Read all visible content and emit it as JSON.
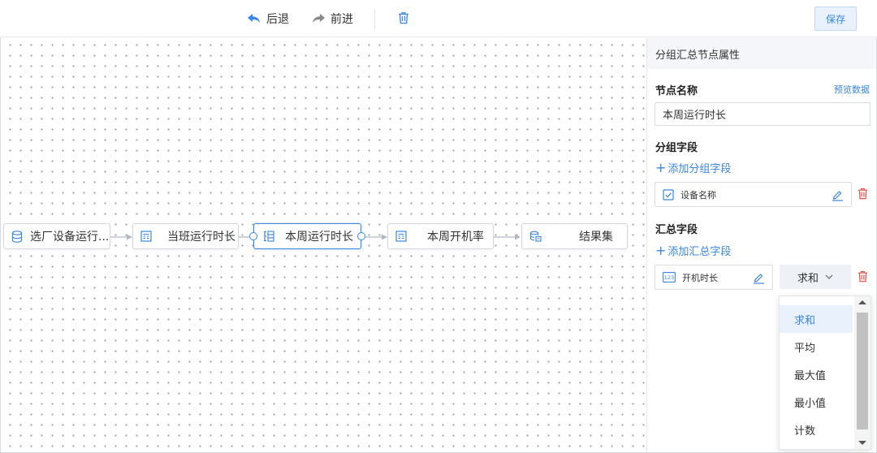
{
  "toolbar": {
    "undo_label": "后退",
    "redo_label": "前进",
    "save_label": "保存"
  },
  "canvas": {
    "nodes": [
      {
        "label": "选厂设备运行...",
        "icon": "database-icon"
      },
      {
        "label": "当班运行时长",
        "icon": "table-icon"
      },
      {
        "label": "本周运行时长",
        "icon": "group-icon",
        "selected": true
      },
      {
        "label": "本周开机率",
        "icon": "table-icon"
      },
      {
        "label": "结果集",
        "icon": "result-icon"
      }
    ]
  },
  "panel": {
    "title": "分组汇总节点属性",
    "node_name_label": "节点名称",
    "preview_label": "预览数据",
    "node_name_value": "本周运行时长",
    "group_section_label": "分组字段",
    "add_group_label": "添加分组字段",
    "group_fields": [
      {
        "name": "设备名称",
        "icon": "checkbox-icon"
      }
    ],
    "summary_section_label": "汇总字段",
    "add_summary_label": "添加汇总字段",
    "summary_fields": [
      {
        "name": "开机时长",
        "icon": "number-123-icon",
        "aggregation": "求和"
      }
    ],
    "aggregation_options": [
      "求和",
      "平均",
      "最大值",
      "最小值",
      "计数"
    ],
    "selected_option": "求和"
  },
  "colors": {
    "accent": "#3a86e3",
    "danger": "#e5534b"
  }
}
